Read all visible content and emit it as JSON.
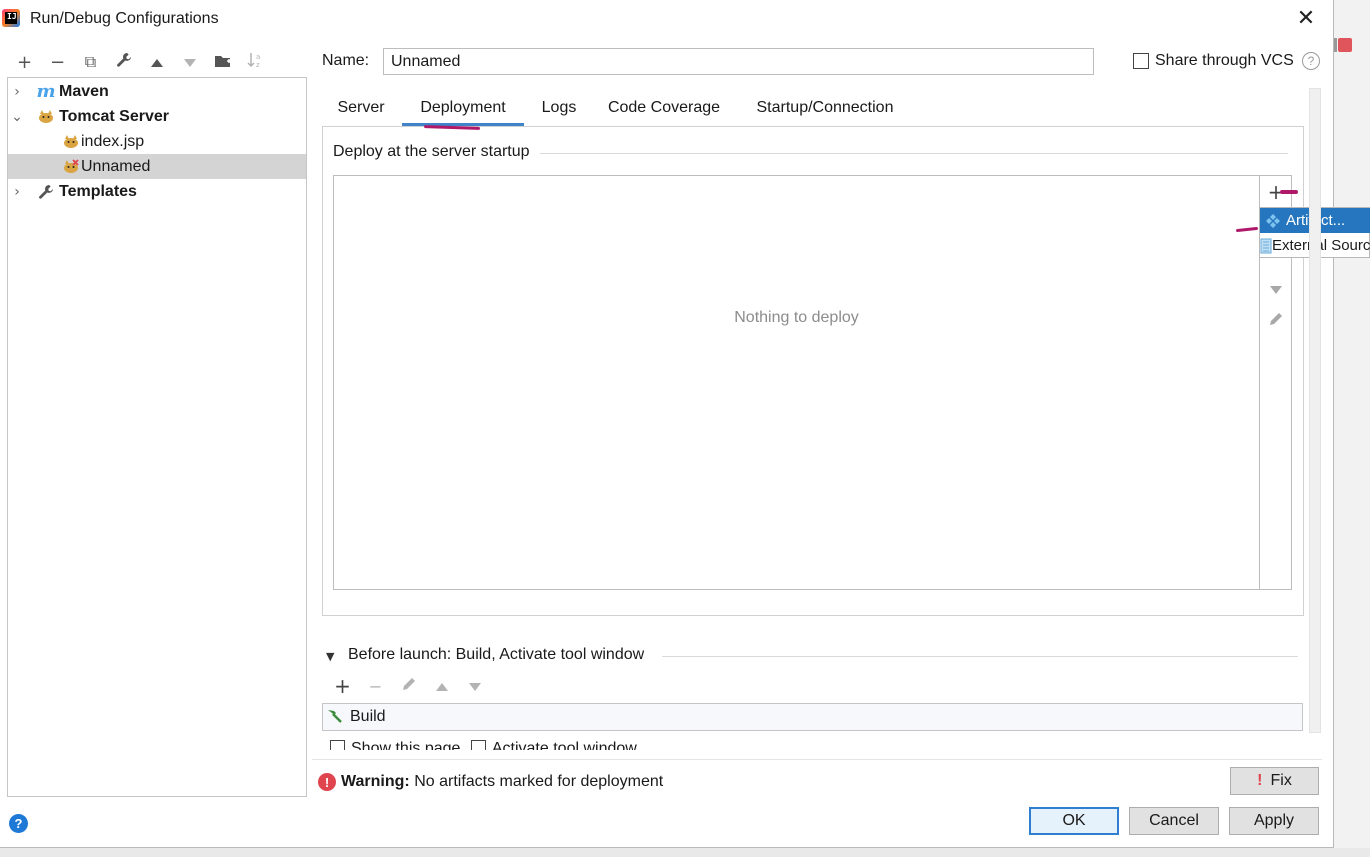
{
  "window": {
    "title": "Run/Debug Configurations",
    "close_glyph": "✕"
  },
  "left_toolbar": [
    {
      "name": "add-icon",
      "glyph": "+"
    },
    {
      "name": "remove-icon",
      "glyph": "−"
    },
    {
      "name": "copy-icon",
      "glyph": "⧉"
    },
    {
      "name": "wrench-icon",
      "glyph": "🔧"
    },
    {
      "name": "move-up-icon",
      "glyph": "▲"
    },
    {
      "name": "move-down-icon",
      "glyph": "▼"
    },
    {
      "name": "folder-icon",
      "glyph": "📁"
    },
    {
      "name": "sort-icon",
      "glyph": "⇅"
    }
  ],
  "tree": {
    "maven": {
      "label": "Maven",
      "icon": "m"
    },
    "tomcat": {
      "label": "Tomcat Server",
      "icon": "cat-icon"
    },
    "index_jsp": {
      "label": "index.jsp"
    },
    "unnamed": {
      "label": "Unnamed"
    },
    "templates": {
      "label": "Templates",
      "icon": "wrench-icon"
    }
  },
  "form": {
    "name_label": "Name:",
    "name_value": "Unnamed",
    "share_label": "Share through VCS",
    "help_glyph": "?"
  },
  "tabs": [
    {
      "label": "Server",
      "active": false
    },
    {
      "label": "Deployment",
      "active": true
    },
    {
      "label": "Logs",
      "active": false
    },
    {
      "label": "Code Coverage",
      "active": false
    },
    {
      "label": "Startup/Connection",
      "active": false
    }
  ],
  "deployment": {
    "section_title": "Deploy at the server startup",
    "empty_text": "Nothing to deploy"
  },
  "popup_menu": [
    {
      "label": "Artifact...",
      "icon": "artifact-icon",
      "selected": true
    },
    {
      "label": "External Source...",
      "icon": "external-source-icon",
      "selected": false
    }
  ],
  "before_launch": {
    "label": "Before launch: Build, Activate tool window",
    "items": [
      "Build"
    ],
    "show_page_label": "Show this page",
    "activate_label": "Activate tool window"
  },
  "warning": {
    "bold": "Warning:",
    "text": "No artifacts marked for deployment"
  },
  "buttons": {
    "fix": "Fix",
    "ok": "OK",
    "cancel": "Cancel",
    "apply": "Apply"
  },
  "colors": {
    "selection_blue": "#2675bf",
    "tab_underline": "#4083c9",
    "error_red": "#e0454f",
    "annotation_magenta": "#b0196a"
  }
}
